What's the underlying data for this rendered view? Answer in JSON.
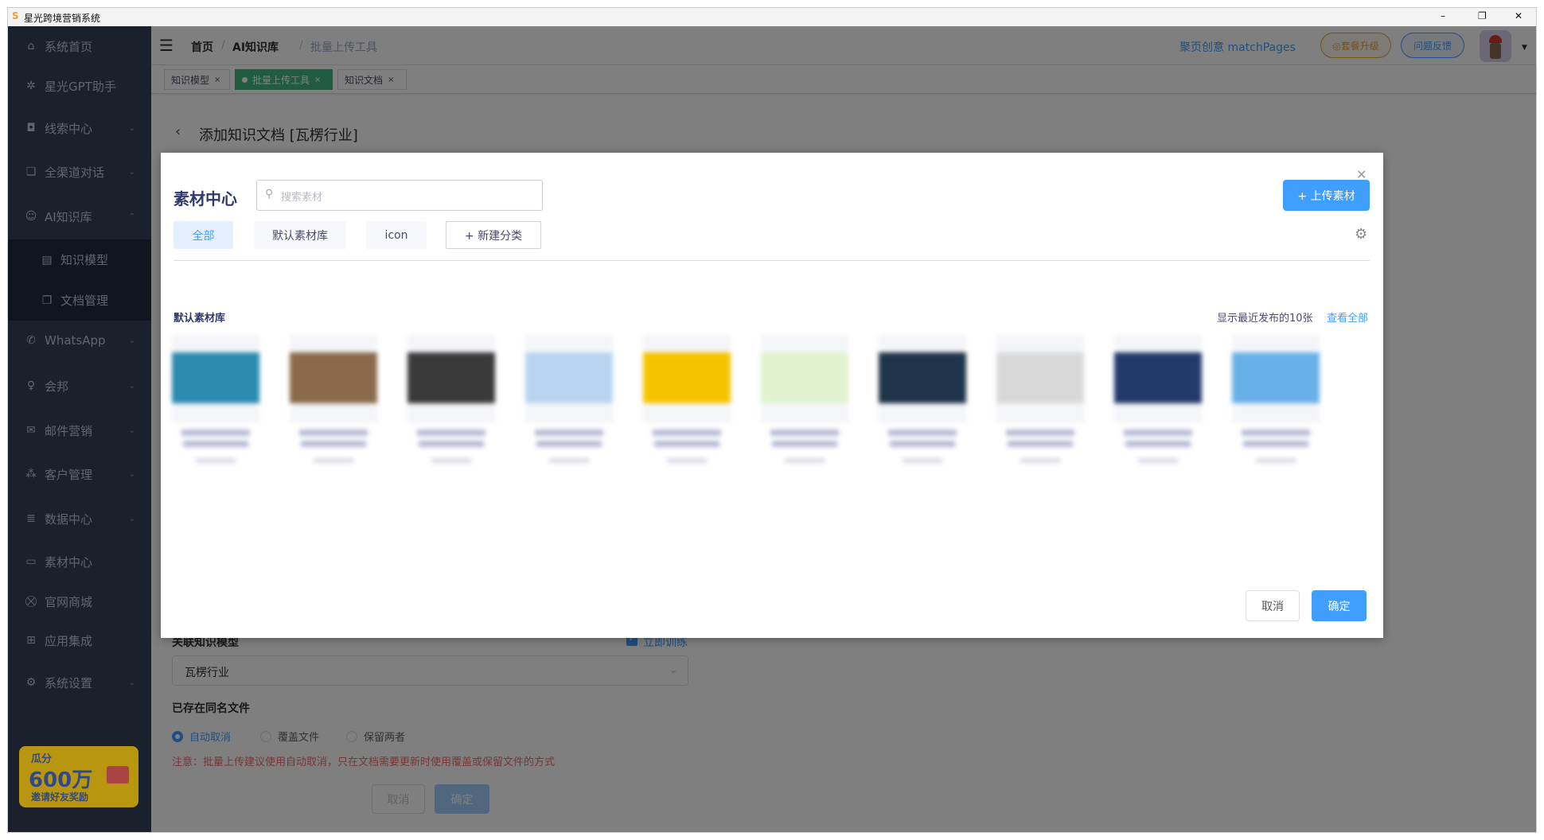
{
  "window": {
    "title": "星光跨境营销系统",
    "controls": [
      "–",
      "❐",
      "✕"
    ]
  },
  "sidebar": {
    "items": [
      {
        "label": "系统首页",
        "icon": "⌂"
      },
      {
        "label": "星光GPT助手",
        "icon": "✲"
      },
      {
        "label": "线索中心",
        "icon": "◘",
        "chev": "⌄"
      },
      {
        "label": "全渠道对话",
        "icon": "❏",
        "chev": "⌄"
      },
      {
        "label": "AI知识库",
        "icon": "☺",
        "chev": "⌃"
      },
      {
        "label": "知识模型",
        "icon": "▤"
      },
      {
        "label": "文档管理",
        "icon": "❐"
      },
      {
        "label": "WhatsApp",
        "icon": "✆",
        "chev": "⌄"
      },
      {
        "label": "会邦",
        "icon": "♀",
        "chev": "⌄"
      },
      {
        "label": "邮件营销",
        "icon": "✉",
        "chev": "⌄"
      },
      {
        "label": "客户管理",
        "icon": "⁂",
        "chev": "⌄"
      },
      {
        "label": "数据中心",
        "icon": "≣",
        "chev": "⌄"
      },
      {
        "label": "素材中心",
        "icon": "▭"
      },
      {
        "label": "官网商城",
        "icon": "⛒"
      },
      {
        "label": "应用集成",
        "icon": "⊞"
      },
      {
        "label": "系统设置",
        "icon": "⚙",
        "chev": "⌄"
      }
    ],
    "banner": {
      "line1": "瓜分",
      "line2": "600万",
      "line3": "邀请好友奖励"
    }
  },
  "header": {
    "breadcrumb": [
      "首页",
      "AI知识库",
      "批量上传工具"
    ],
    "org": "聚页创意 matchPages",
    "upgrade": "◎套餐升级",
    "feedback": "问题反馈"
  },
  "tags": [
    {
      "label": "知识模型",
      "active": false
    },
    {
      "label": "批量上传工具",
      "active": true
    },
    {
      "label": "知识文档",
      "active": false
    }
  ],
  "page": {
    "title": "添加知识文档 [瓦楞行业]",
    "model_label": "关联知识模型",
    "train_label": "立即训练",
    "model_value": "瓦楞行业",
    "dup_label": "已存在同名文件",
    "radios": [
      "自动取消",
      "覆盖文件",
      "保留两者"
    ],
    "selected_radio": 0,
    "note": "注意：批量上传建议使用自动取消，只在文档需要更新时使用覆盖或保留文件的方式",
    "cancel": "取消",
    "confirm": "确定"
  },
  "modal": {
    "title": "素材中心",
    "search_placeholder": "搜索素材",
    "upload": "+ 上传素材",
    "tabs": [
      "全部",
      "默认素材库",
      "icon"
    ],
    "new_category": "+ 新建分类",
    "section": "默认素材库",
    "recent": "显示最近发布的10张",
    "view_all": "查看全部",
    "cancel": "取消",
    "confirm": "确定",
    "thumb_colors": [
      "#2a8ab0",
      "#8a6a4a",
      "#3a3a3a",
      "#b8d4f0",
      "#f5c400",
      "#dff3d0",
      "#1f3448",
      "#d8d8d8",
      "#223a6a",
      "#6ab0e8"
    ]
  },
  "colors": {
    "primary": "#409eff",
    "sidebar": "#34425a",
    "tag_active": "#42b983",
    "warning": "#e6a23c",
    "danger": "#f56c6c"
  }
}
